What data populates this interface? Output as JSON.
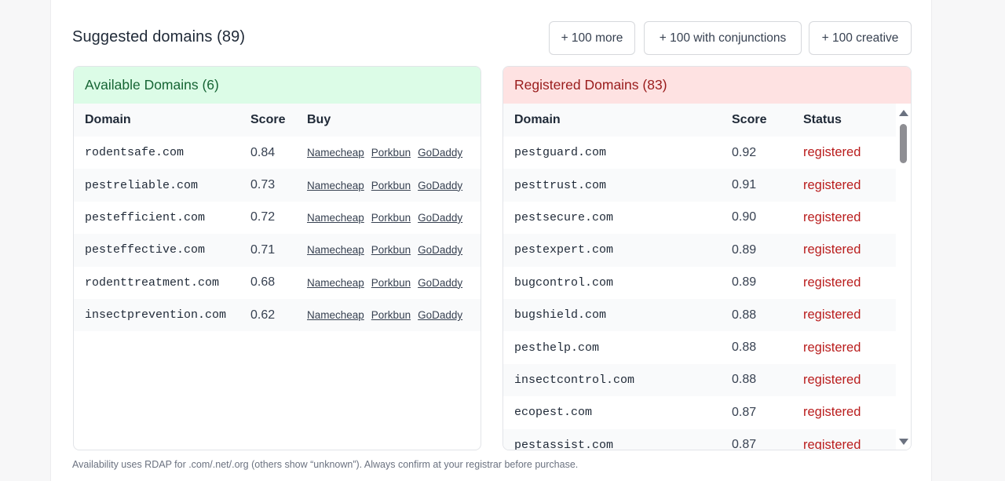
{
  "header": {
    "title": "Suggested domains (89)",
    "buttons": [
      "+ 100 more",
      "+ 100 with conjunctions",
      "+ 100 creative"
    ]
  },
  "available": {
    "heading": "Available Domains (6)",
    "columns": [
      "Domain",
      "Score",
      "Buy"
    ],
    "registrars": [
      "Namecheap",
      "Porkbun",
      "GoDaddy"
    ],
    "rows": [
      {
        "domain": "rodentsafe.com",
        "score": "0.84"
      },
      {
        "domain": "pestreliable.com",
        "score": "0.73"
      },
      {
        "domain": "pestefficient.com",
        "score": "0.72"
      },
      {
        "domain": "pesteffective.com",
        "score": "0.71"
      },
      {
        "domain": "rodenttreatment.com",
        "score": "0.68"
      },
      {
        "domain": "insectprevention.com",
        "score": "0.62"
      }
    ]
  },
  "registered": {
    "heading": "Registered Domains (83)",
    "columns": [
      "Domain",
      "Score",
      "Status"
    ],
    "rows": [
      {
        "domain": "pestguard.com",
        "score": "0.92",
        "status": "registered"
      },
      {
        "domain": "pesttrust.com",
        "score": "0.91",
        "status": "registered"
      },
      {
        "domain": "pestsecure.com",
        "score": "0.90",
        "status": "registered"
      },
      {
        "domain": "pestexpert.com",
        "score": "0.89",
        "status": "registered"
      },
      {
        "domain": "bugcontrol.com",
        "score": "0.89",
        "status": "registered"
      },
      {
        "domain": "bugshield.com",
        "score": "0.88",
        "status": "registered"
      },
      {
        "domain": "pesthelp.com",
        "score": "0.88",
        "status": "registered"
      },
      {
        "domain": "insectcontrol.com",
        "score": "0.88",
        "status": "registered"
      },
      {
        "domain": "ecopest.com",
        "score": "0.87",
        "status": "registered"
      },
      {
        "domain": "pestassist.com",
        "score": "0.87",
        "status": "registered"
      }
    ]
  },
  "footnote": "Availability uses RDAP for .com/.net/.org (others show “unknown”). Always confirm at your registrar before purchase.",
  "colors": {
    "available_bg": "#dcfce7",
    "available_text": "#166534",
    "registered_bg": "#fee2e2",
    "registered_text": "#991b1b",
    "status_text": "#b91c1c"
  }
}
